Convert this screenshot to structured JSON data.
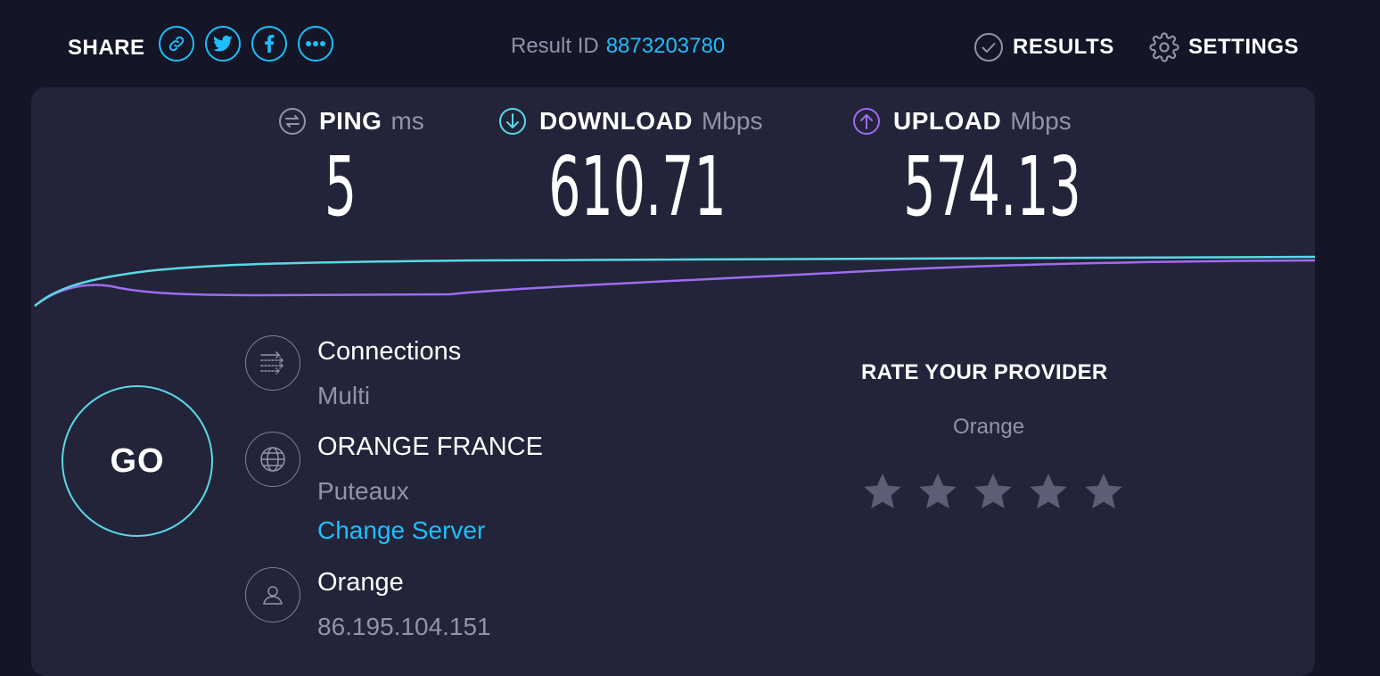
{
  "header": {
    "share_label": "SHARE",
    "share_icons": [
      "link-icon",
      "twitter-icon",
      "facebook-icon",
      "more-icon"
    ],
    "result_id_label": "Result ID",
    "result_id": "8873203780",
    "results_label": "RESULTS",
    "settings_label": "SETTINGS"
  },
  "metrics": {
    "ping": {
      "label": "PING",
      "unit": "ms",
      "value": "5"
    },
    "download": {
      "label": "DOWNLOAD",
      "unit": "Mbps",
      "value": "610.71"
    },
    "upload": {
      "label": "UPLOAD",
      "unit": "Mbps",
      "value": "574.13"
    }
  },
  "go_label": "GO",
  "connections": {
    "title": "Connections",
    "value": "Multi"
  },
  "server": {
    "title": "ORANGE FRANCE",
    "location": "Puteaux",
    "change_label": "Change Server"
  },
  "isp": {
    "title": "Orange",
    "ip": "86.195.104.151"
  },
  "rate": {
    "title": "RATE YOUR PROVIDER",
    "provider": "Orange",
    "stars_total": 5,
    "stars_selected": 0
  },
  "colors": {
    "background": "#141526",
    "panel": "#232439",
    "accent_blue": "#1cbfff",
    "download": "#59d8e6",
    "upload": "#9d6cf0",
    "muted_text": "#9193a8"
  }
}
